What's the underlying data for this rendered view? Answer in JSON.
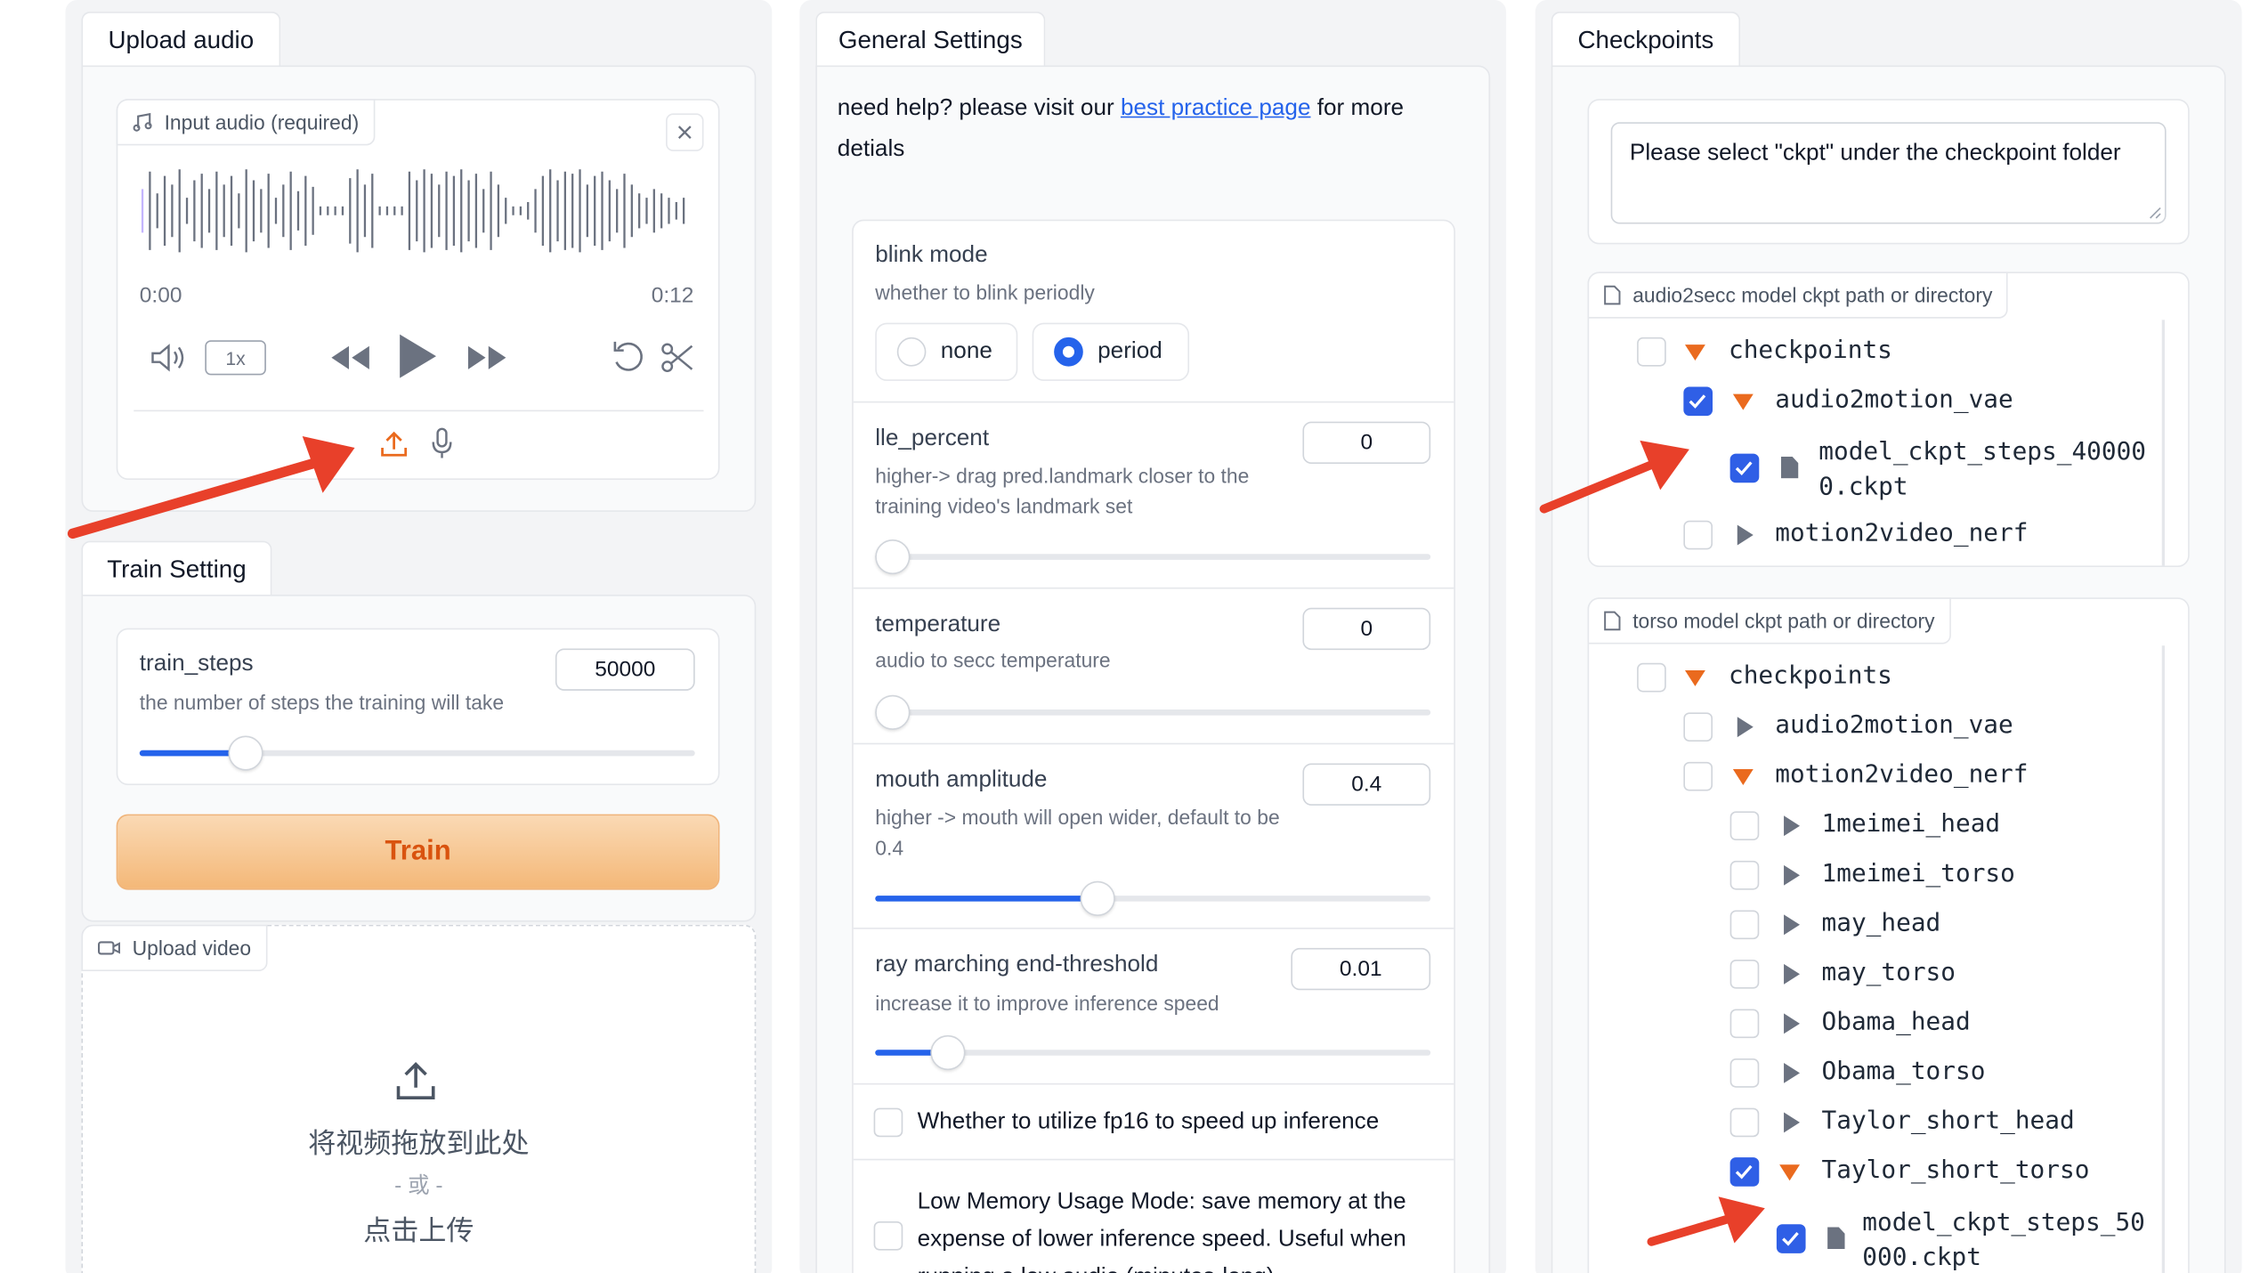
{
  "upload_audio": {
    "tab_label": "Upload audio",
    "audio_label": "Input audio (required)",
    "time_start": "0:00",
    "time_end": "0:12",
    "speed": "1x",
    "icons": [
      "music-icon",
      "close-icon",
      "volume-icon",
      "rewind-icon",
      "play-icon",
      "forward-icon",
      "undo-icon",
      "scissors-icon",
      "upload-icon",
      "microphone-icon"
    ]
  },
  "train_setting": {
    "tab_label": "Train Setting",
    "steps_label": "train_steps",
    "steps_info": "the number of steps the training will take",
    "steps_value": "50000",
    "steps_fraction": 0.19,
    "train_button": "Train"
  },
  "upload_video": {
    "chip_label": "Upload video",
    "drop_text": "将视频拖放到此处",
    "or_text": "- 或 -",
    "click_text": "点击上传"
  },
  "general": {
    "tab_label": "General Settings",
    "help_prefix": "need help? please visit our ",
    "help_link": "best practice page",
    "help_suffix": " for more",
    "help_line2": "detials",
    "blink": {
      "label": "blink mode",
      "info": "whether to blink periodly",
      "options": [
        "none",
        "period"
      ],
      "selected": "period"
    },
    "lle": {
      "label": "lle_percent",
      "info1": "higher-> drag pred.landmark closer to the",
      "info2": "training video's landmark set",
      "value": "0",
      "fraction": 0
    },
    "temperature": {
      "label": "temperature",
      "info": "audio to secc temperature",
      "value": "0",
      "fraction": 0
    },
    "mouth": {
      "label": "mouth amplitude",
      "info1": "higher -> mouth will open wider, default to be",
      "info2": "0.4",
      "value": "0.4",
      "fraction": 0.4
    },
    "ray": {
      "label": "ray marching end-threshold",
      "info": "increase it to improve inference speed",
      "value": "0.01",
      "fraction": 0.13
    },
    "fp16": {
      "label": "Whether to utilize fp16 to speed up inference",
      "checked": false
    },
    "lowmem": {
      "line1": "Low Memory Usage Mode: save memory at the",
      "line2": "expense of lower inference speed. Useful when",
      "line3": "running a low audio (minutes-long).",
      "checked": false
    }
  },
  "checkpoints": {
    "tab_label": "Checkpoints",
    "note": "Please select \"ckpt\" under the checkpoint folder",
    "audio2secc": {
      "label": "audio2secc model ckpt path or directory",
      "items": [
        {
          "name": "checkpoints",
          "checked": false,
          "expanded": true
        },
        {
          "name": "audio2motion_vae",
          "checked": true,
          "expanded": true
        },
        {
          "name_line1": "model_ckpt_steps_40000",
          "name_line2": "0.ckpt",
          "checked": true,
          "type": "file"
        },
        {
          "name": "motion2video_nerf",
          "checked": false,
          "expanded": false
        }
      ]
    },
    "torso": {
      "label": "torso model ckpt path or directory",
      "items": [
        {
          "name": "checkpoints",
          "checked": false,
          "expanded": true
        },
        {
          "name": "audio2motion_vae",
          "checked": false,
          "expanded": false
        },
        {
          "name": "motion2video_nerf",
          "checked": false,
          "expanded": true
        },
        {
          "name": "1meimei_head",
          "checked": false,
          "expanded": false
        },
        {
          "name": "1meimei_torso",
          "checked": false,
          "expanded": false
        },
        {
          "name": "may_head",
          "checked": false,
          "expanded": false
        },
        {
          "name": "may_torso",
          "checked": false,
          "expanded": false
        },
        {
          "name": "Obama_head",
          "checked": false,
          "expanded": false
        },
        {
          "name": "Obama_torso",
          "checked": false,
          "expanded": false
        },
        {
          "name": "Taylor_short_head",
          "checked": false,
          "expanded": false
        },
        {
          "name": "Taylor_short_torso",
          "checked": true,
          "expanded": true
        },
        {
          "name_line1": "model_ckpt_steps_50",
          "name_line2": "000.ckpt",
          "checked": true,
          "type": "file"
        }
      ]
    }
  },
  "colors": {
    "accent": "#2563eb",
    "arrow": "#e8402a",
    "train_button": "#f5c08a",
    "caret_open": "#ea6a1e"
  }
}
